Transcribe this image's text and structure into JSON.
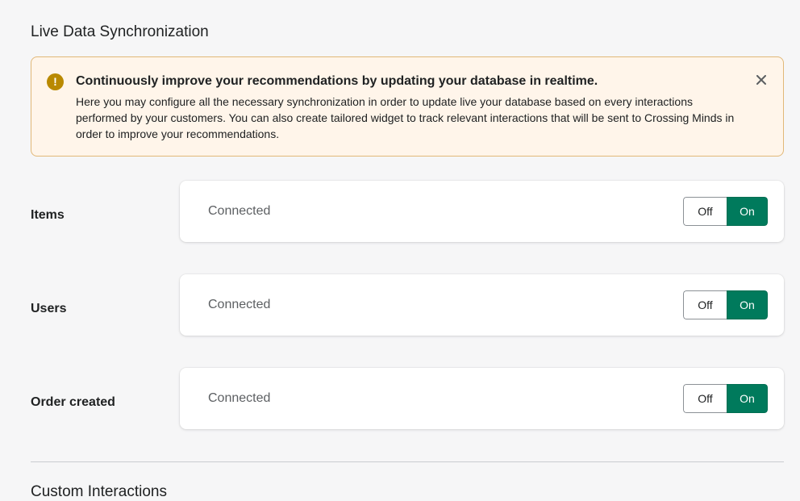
{
  "page": {
    "title": "Live Data Synchronization"
  },
  "banner": {
    "icon": "exclamation-icon",
    "title": "Continuously improve your recommendations by updating your database in realtime.",
    "body": "Here you may configure all the necessary synchronization in order to update live your database based on every interactions performed by your customers. You can also create tailored widget to track relevant interactions that will be sent to Crossing Minds in order to improve your recommendations.",
    "close_icon": "close-icon"
  },
  "sync_rows": [
    {
      "label": "Items",
      "status": "Connected",
      "off_label": "Off",
      "on_label": "On",
      "state": "On"
    },
    {
      "label": "Users",
      "status": "Connected",
      "off_label": "Off",
      "on_label": "On",
      "state": "On"
    },
    {
      "label": "Order created",
      "status": "Connected",
      "off_label": "Off",
      "on_label": "On",
      "state": "On"
    }
  ],
  "section2": {
    "title": "Custom Interactions"
  },
  "colors": {
    "accent": "#007a5c",
    "warning_bg": "#fff5ea",
    "warning_border": "#e1b878",
    "warning_icon": "#b98900"
  }
}
